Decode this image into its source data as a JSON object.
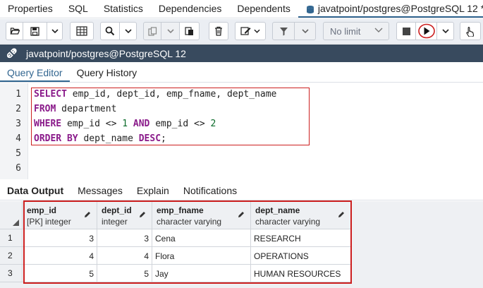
{
  "top_tabs": [
    {
      "label": "Properties"
    },
    {
      "label": "SQL"
    },
    {
      "label": "Statistics"
    },
    {
      "label": "Dependencies"
    },
    {
      "label": "Dependents"
    },
    {
      "label": "javatpoint/postgres@PostgreSQL 12 *"
    }
  ],
  "toolbar": {
    "limit_label": "No limit"
  },
  "connection": {
    "label": "javatpoint/postgres@PostgreSQL 12"
  },
  "editor_tabs": [
    {
      "label": "Query Editor"
    },
    {
      "label": "Query History"
    }
  ],
  "editor": {
    "line_numbers": [
      "1",
      "2",
      "3",
      "4",
      "5",
      "6"
    ],
    "lines": [
      {
        "kw1": "SELECT",
        "text1": " emp_id, dept_id, emp_fname, dept_name"
      },
      {
        "kw1": "FROM",
        "text1": " department"
      },
      {
        "kw1": "WHERE",
        "text1": " emp_id <> ",
        "num1": "1",
        "kw2": " AND",
        "text2": " emp_id <> ",
        "num2": "2"
      },
      {
        "kw1": "ORDER BY",
        "text1": " dept_name ",
        "kw2": "DESC",
        "text2": ";"
      }
    ]
  },
  "result_tabs": [
    {
      "label": "Data Output"
    },
    {
      "label": "Messages"
    },
    {
      "label": "Explain"
    },
    {
      "label": "Notifications"
    }
  ],
  "grid": {
    "columns": [
      {
        "name": "emp_id",
        "type": "[PK] integer"
      },
      {
        "name": "dept_id",
        "type": "integer"
      },
      {
        "name": "emp_fname",
        "type": "character varying"
      },
      {
        "name": "dept_name",
        "type": "character varying"
      }
    ],
    "rows": [
      {
        "n": "1",
        "cells": [
          "3",
          "3",
          "Cena",
          "RESEARCH"
        ]
      },
      {
        "n": "2",
        "cells": [
          "4",
          "4",
          "Flora",
          "OPERATIONS"
        ]
      },
      {
        "n": "3",
        "cells": [
          "5",
          "5",
          "Jay",
          "HUMAN RESOURCES"
        ]
      }
    ]
  },
  "colors": {
    "accent": "#326690",
    "connection_bar": "#384a5e",
    "highlight": "#cc1f1f",
    "keyword": "#8a1a8a",
    "number": "#0b6b2a"
  }
}
